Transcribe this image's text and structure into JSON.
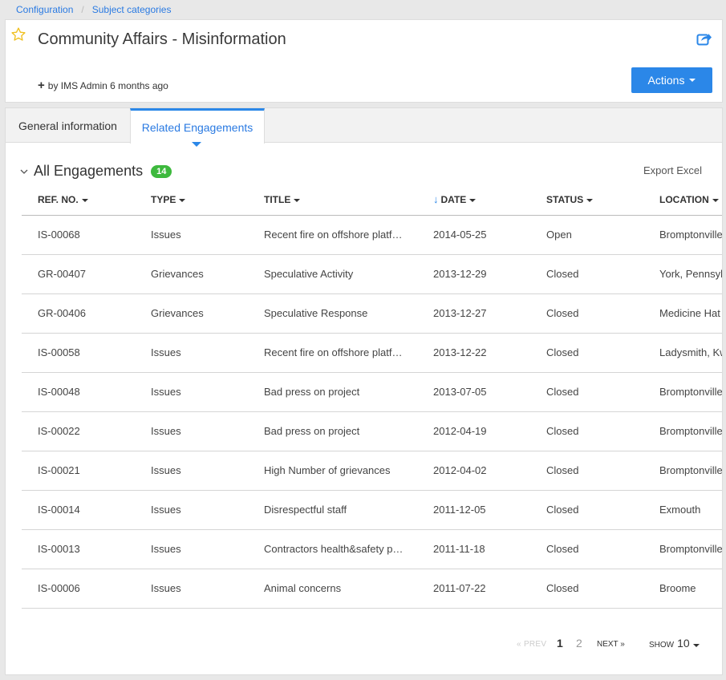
{
  "breadcrumb": [
    "Configuration",
    "Subject categories"
  ],
  "page": {
    "title": "Community Affairs - Misinformation",
    "byline": "by IMS Admin 6 months ago",
    "actions_label": "Actions"
  },
  "tabs": [
    "General information",
    "Related Engagements"
  ],
  "section": {
    "title": "All Engagements",
    "count": "14",
    "export_label": "Export Excel"
  },
  "columns": [
    "REF. NO.",
    "TYPE",
    "TITLE",
    "DATE",
    "STATUS",
    "LOCATION"
  ],
  "rows": [
    [
      "IS-00068",
      "Issues",
      "Recent fire on offshore platform",
      "2014-05-25",
      "Open",
      "Bromptonville"
    ],
    [
      "GR-00407",
      "Grievances",
      "Speculative Activity",
      "2013-12-29",
      "Closed",
      "York, Pennsylvania"
    ],
    [
      "GR-00406",
      "Grievances",
      "Speculative Response",
      "2013-12-27",
      "Closed",
      "Medicine Hat"
    ],
    [
      "IS-00058",
      "Issues",
      "Recent fire on offshore platform",
      "2013-12-22",
      "Closed",
      "Ladysmith, KwaZulu"
    ],
    [
      "IS-00048",
      "Issues",
      "Bad press on project",
      "2013-07-05",
      "Closed",
      "Bromptonville"
    ],
    [
      "IS-00022",
      "Issues",
      "Bad press on project",
      "2012-04-19",
      "Closed",
      "Bromptonville"
    ],
    [
      "IS-00021",
      "Issues",
      "High Number of grievances",
      "2012-04-02",
      "Closed",
      "Bromptonville"
    ],
    [
      "IS-00014",
      "Issues",
      "Disrespectful staff",
      "2011-12-05",
      "Closed",
      "Exmouth"
    ],
    [
      "IS-00013",
      "Issues",
      "Contractors health&safety policy",
      "2011-11-18",
      "Closed",
      "Bromptonville"
    ],
    [
      "IS-00006",
      "Issues",
      "Animal concerns",
      "2011-07-22",
      "Closed",
      "Broome"
    ]
  ],
  "pagination": {
    "prev": "« PREV",
    "pages": [
      "1",
      "2"
    ],
    "next": "NEXT »",
    "show_label": "SHOW",
    "show_value": "10"
  },
  "colors": {
    "accent": "#2b87e8",
    "link": "#2a7ae2",
    "badge": "#3db93d"
  },
  "icons": {
    "favorite": "star-outline-icon",
    "share": "share-icon",
    "collapse": "chevron-down-icon",
    "sort": "sort-down-arrow-icon"
  }
}
